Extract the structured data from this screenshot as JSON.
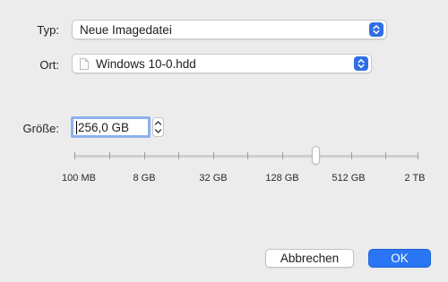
{
  "form": {
    "type_label": "Typ:",
    "type_value": "Neue Imagedatei",
    "location_label": "Ort:",
    "location_value": "Windows 10-0.hdd",
    "size_label": "Größe:",
    "size_value": "256,0 GB"
  },
  "slider": {
    "tick_labels": [
      "100 MB",
      "8 GB",
      "32 GB",
      "128 GB",
      "512 GB",
      "2 TB"
    ],
    "selected_value": "256,0 GB"
  },
  "buttons": {
    "cancel_label": "Abbrechen",
    "ok_label": "OK"
  },
  "colors": {
    "accent": "#2a75f3",
    "window_background": "#ececec",
    "focus_ring": "#8cb1ee"
  },
  "icons": {
    "popup_chevron": "up-down-chevron-icon",
    "file": "document-icon",
    "stepper": "stepper-arrows-icon"
  }
}
